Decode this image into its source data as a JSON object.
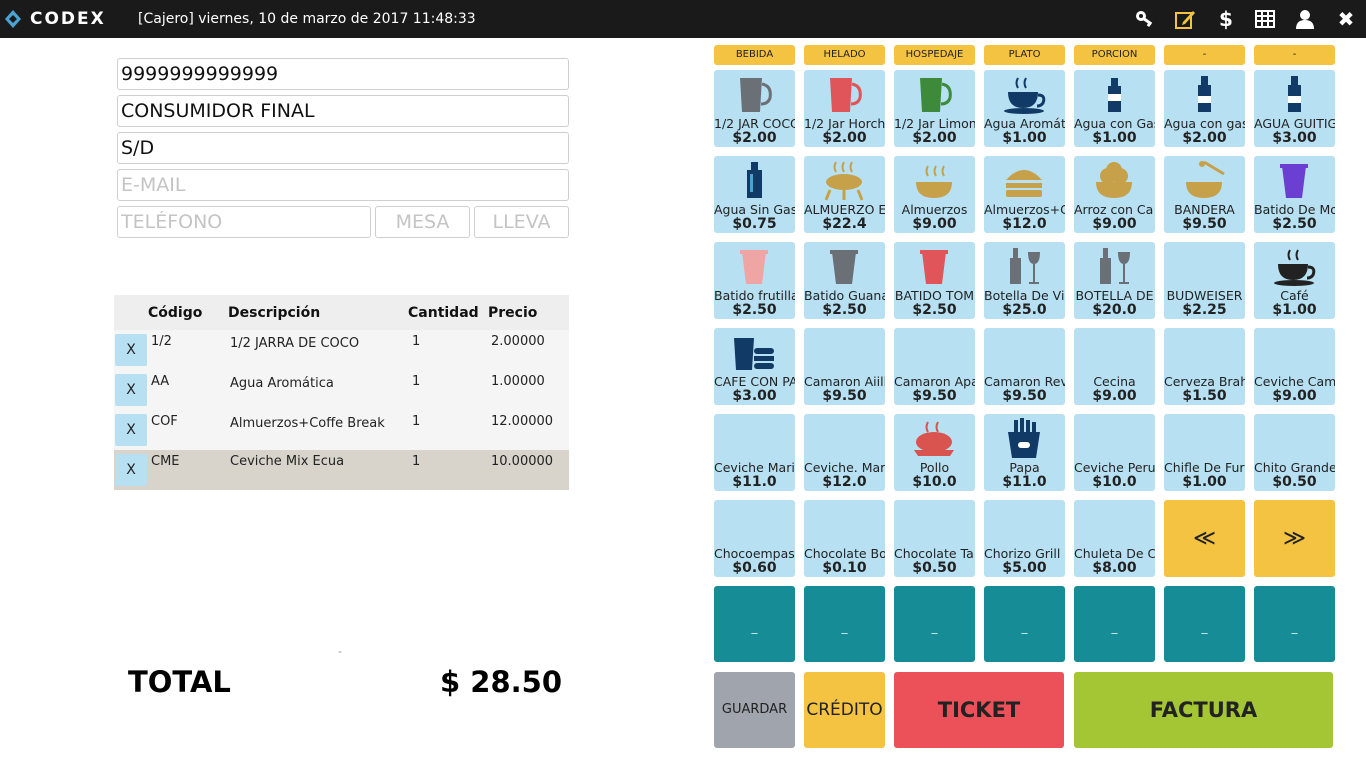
{
  "topbar": {
    "brand": "CODEX",
    "title": "[Cajero]  viernes, 10 de marzo de 2017 11:48:33",
    "icons": [
      "key-icon",
      "edit-icon",
      "dollar-icon",
      "table-icon",
      "user-icon",
      "close-icon"
    ],
    "dollar_glyph": "$",
    "close_glyph": "✖"
  },
  "customer": {
    "ruc": "9999999999999",
    "name": "CONSUMIDOR FINAL",
    "address": "S/D",
    "email_placeholder": "E-MAIL",
    "phone_placeholder": "TELÉFONO",
    "mesa_label": "MESA",
    "lleva_label": "LLEVA"
  },
  "ticket": {
    "columns": [
      "Código",
      "Descripción",
      "Cantidad",
      "Precio"
    ],
    "remove_label": "X",
    "rows": [
      {
        "code": "1/2",
        "desc": "1/2 JARRA DE COCO",
        "qty": "1",
        "price": "2.00000"
      },
      {
        "code": "AA",
        "desc": "Agua Aromática",
        "qty": "1",
        "price": "1.00000"
      },
      {
        "code": "COF",
        "desc": "Almuerzos+Coffe Break",
        "qty": "1",
        "price": "12.00000"
      },
      {
        "code": "CME",
        "desc": "Ceviche Mix  Ecua",
        "qty": "1",
        "price": "10.00000"
      }
    ]
  },
  "dash": "-",
  "total": {
    "label": "TOTAL",
    "value": "$ 28.50"
  },
  "categories": [
    "BEBIDA",
    "HELADO",
    "HOSPEDAJE",
    "PLATO",
    "PORCION",
    "-",
    "-"
  ],
  "products": [
    {
      "name": "1/2 JAR COCO",
      "price": "$2.00",
      "icon": "pitcher-gray-icon"
    },
    {
      "name": "1/2 Jar Horch",
      "price": "$2.00",
      "icon": "pitcher-red-icon"
    },
    {
      "name": "1/2 Jar Limon",
      "price": "$2.00",
      "icon": "pitcher-green-icon"
    },
    {
      "name": "Agua Aromát",
      "price": "$1.00",
      "icon": "tea-cup-icon"
    },
    {
      "name": "Agua con Gas",
      "price": "$1.00",
      "icon": "sparkling-bottle-icon"
    },
    {
      "name": "Agua con gas",
      "price": "$2.00",
      "icon": "bottle-icon"
    },
    {
      "name": "AGUA GUITIG",
      "price": "$3.00",
      "icon": "bottle-icon"
    },
    {
      "name": "Agua Sin Gas",
      "price": "$0.75",
      "icon": "water-bottle-icon"
    },
    {
      "name": "ALMUERZO E",
      "price": "$22.4",
      "icon": "grill-icon"
    },
    {
      "name": "Almuerzos",
      "price": "$9.00",
      "icon": "hot-bowl-icon"
    },
    {
      "name": "Almuerzos+C",
      "price": "$12.0",
      "icon": "burger-icon"
    },
    {
      "name": "Arroz con Ca",
      "price": "$9.00",
      "icon": "rice-bowl-icon"
    },
    {
      "name": "BANDERA",
      "price": "$9.50",
      "icon": "honey-bowl-icon"
    },
    {
      "name": "Batido De Mo",
      "price": "$2.50",
      "icon": "cup-purple-icon"
    },
    {
      "name": "Batido frutilla",
      "price": "$2.50",
      "icon": "cup-pink-icon"
    },
    {
      "name": "Batido Guana",
      "price": "$2.50",
      "icon": "cup-gray-icon"
    },
    {
      "name": "BATIDO TOM",
      "price": "$2.50",
      "icon": "cup-red-icon"
    },
    {
      "name": "Botella De Vi",
      "price": "$25.0",
      "icon": "wine-icon"
    },
    {
      "name": "BOTELLA DE",
      "price": "$20.0",
      "icon": "wine-icon"
    },
    {
      "name": "BUDWEISER",
      "price": "$2.25",
      "icon": ""
    },
    {
      "name": "Café",
      "price": "$1.00",
      "icon": "coffee-cup-icon"
    },
    {
      "name": "CAFE CON PA",
      "price": "$3.00",
      "icon": "coffee-sandwich-icon"
    },
    {
      "name": "Camaron Aiill",
      "price": "$9.50",
      "icon": ""
    },
    {
      "name": "Camaron Apa",
      "price": "$9.50",
      "icon": ""
    },
    {
      "name": "Camaron Rev",
      "price": "$9.50",
      "icon": ""
    },
    {
      "name": "Cecina",
      "price": "$9.00",
      "icon": ""
    },
    {
      "name": "Cerveza Brah",
      "price": "$1.50",
      "icon": ""
    },
    {
      "name": "Ceviche Cam",
      "price": "$9.00",
      "icon": ""
    },
    {
      "name": "Ceviche Mari",
      "price": "$11.0",
      "icon": ""
    },
    {
      "name": "Ceviche. Mar",
      "price": "$12.0",
      "icon": ""
    },
    {
      "name": "Pollo",
      "price": "$10.0",
      "icon": "roast-chicken-icon"
    },
    {
      "name": "Papa",
      "price": "$11.0",
      "icon": "fries-icon"
    },
    {
      "name": "Ceviche Peru",
      "price": "$10.0",
      "icon": ""
    },
    {
      "name": "Chifle De Fur",
      "price": "$1.00",
      "icon": ""
    },
    {
      "name": "Chito Grande",
      "price": "$0.50",
      "icon": ""
    },
    {
      "name": "Chocoempast",
      "price": "$0.60",
      "icon": ""
    },
    {
      "name": "Chocolate Bo",
      "price": "$0.10",
      "icon": ""
    },
    {
      "name": "Chocolate Ta",
      "price": "$0.50",
      "icon": ""
    },
    {
      "name": "Chorizo Grill",
      "price": "$5.00",
      "icon": ""
    },
    {
      "name": "Chuleta De C",
      "price": "$8.00",
      "icon": ""
    }
  ],
  "nav": {
    "prev": "≪",
    "next": "≫"
  },
  "teal_buttons": [
    "_",
    "_",
    "_",
    "_",
    "_",
    "_",
    "_"
  ],
  "actions": {
    "guardar": "GUARDAR",
    "credito": "CRÉDITO",
    "ticket": "TICKET",
    "factura": "FACTURA"
  },
  "colors": {
    "category": "#f5c342",
    "product": "#b7e1f3",
    "teal": "#168c96",
    "guardar": "#a0a4ad",
    "credito": "#f5c342",
    "ticket": "#ec5058",
    "factura": "#a4c634"
  }
}
